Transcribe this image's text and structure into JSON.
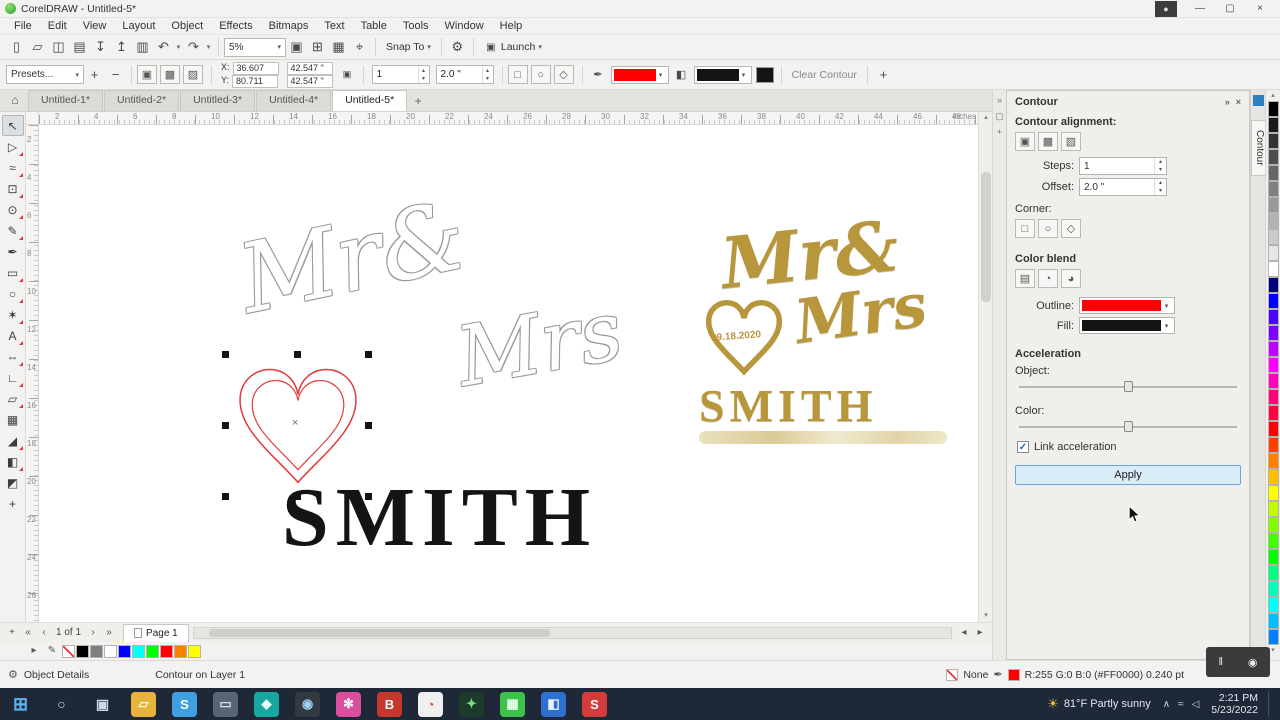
{
  "window": {
    "title": "CorelDRAW - Untitled-5*"
  },
  "icons": {
    "minimize": "—",
    "maximize": "▢",
    "close": "×",
    "account": "●",
    "dropdown": "▾",
    "plus": "+",
    "minus": "−",
    "gear": "⚙",
    "pen": "✒",
    "pencil": "✎",
    "house": "⌂",
    "check": "✓",
    "spin_up": "▴",
    "spin_down": "▾",
    "arrow_left": "◂",
    "arrow_right": "▸",
    "arrow_up": "▴",
    "arrow_down": "▾",
    "first": "«",
    "prev": "‹",
    "next": "›",
    "last": "»",
    "chevrons": "»",
    "panel": "▤",
    "page": "▢",
    "pause": "‖",
    "camera": "◉",
    "lock": "▣",
    "launch": "▣",
    "fill": "◧"
  },
  "menus": [
    "File",
    "Edit",
    "View",
    "Layout",
    "Object",
    "Effects",
    "Bitmaps",
    "Text",
    "Table",
    "Tools",
    "Window",
    "Help"
  ],
  "toolbar": {
    "left_icons": [
      {
        "name": "new-document-icon",
        "glyph": "▯"
      },
      {
        "name": "open-icon",
        "glyph": "▱"
      },
      {
        "name": "save-icon",
        "glyph": "◫"
      },
      {
        "name": "print-icon",
        "glyph": "▤"
      },
      {
        "name": "import-icon",
        "glyph": "↧"
      },
      {
        "name": "export-icon",
        "glyph": "↥"
      },
      {
        "name": "publish-pdf-icon",
        "glyph": "▥"
      },
      {
        "name": "undo-icon",
        "glyph": "↶"
      },
      {
        "name": "undo-dropdown-icon",
        "glyph": "▾"
      },
      {
        "name": "redo-icon",
        "glyph": "↷"
      },
      {
        "name": "redo-dropdown-icon",
        "glyph": "▾"
      }
    ],
    "zoom_value": "5%",
    "mid_icons": [
      {
        "name": "fullscreen-preview-icon",
        "glyph": "▣"
      },
      {
        "name": "show-rulers-icon",
        "glyph": "⊞"
      },
      {
        "name": "show-grid-icon",
        "glyph": "▦"
      },
      {
        "name": "guidelines-icon",
        "glyph": "⌖"
      }
    ],
    "snap_to_label": "Snap To",
    "launch_label": "Launch"
  },
  "property_bar": {
    "presets_label": "Presets...",
    "direction_icons": [
      {
        "name": "to-center-icon",
        "glyph": "▣"
      },
      {
        "name": "inside-contour-icon",
        "glyph": "▩"
      },
      {
        "name": "outside-contour-icon",
        "glyph": "▨"
      }
    ],
    "x_label": "X:",
    "x_value": "36.607",
    "y_label": "Y:",
    "y_value": "80.711",
    "width_value": "42.547 \"",
    "height_value": "42.547 \"",
    "steps_value": "1",
    "offset_value": "2.0 \"",
    "corner_icons": [
      {
        "name": "mitered-corner-icon",
        "glyph": "□"
      },
      {
        "name": "round-corner-icon",
        "glyph": "○"
      },
      {
        "name": "bevel-corner-icon",
        "glyph": "◇"
      }
    ],
    "outline_color": "#ff0000",
    "fill_color": "#141414",
    "clear_button": "Clear Contour"
  },
  "document_tabs": {
    "tabs": [
      "Untitled-1*",
      "Untitled-2*",
      "Untitled-3*",
      "Untitled-4*",
      "Untitled-5*"
    ],
    "active_index": 4
  },
  "ruler": {
    "units": "inches",
    "h_numbers": [
      "2",
      "4",
      "6",
      "8",
      "10",
      "12",
      "14",
      "16",
      "18",
      "20",
      "22",
      "24",
      "26",
      "28",
      "30",
      "32",
      "34",
      "36",
      "38",
      "40",
      "42",
      "44",
      "46",
      "48"
    ],
    "v_numbers": [
      "2",
      "4",
      "6",
      "8",
      "10",
      "12",
      "14",
      "16",
      "18",
      "20",
      "22",
      "24",
      "26"
    ]
  },
  "toolbox": [
    {
      "name": "pick-tool",
      "glyph": "↖",
      "selected": true
    },
    {
      "name": "shape-tool",
      "glyph": "▷",
      "badge": true
    },
    {
      "name": "smooth-tool",
      "glyph": "≈",
      "badge": true
    },
    {
      "name": "crop-tool",
      "glyph": "⊡",
      "badge": true
    },
    {
      "name": "zoom-tool",
      "glyph": "⊙",
      "badge": true
    },
    {
      "name": "freehand-tool",
      "glyph": "✎",
      "badge": true
    },
    {
      "name": "artistic-media-tool",
      "glyph": "✒"
    },
    {
      "name": "rectangle-tool",
      "glyph": "▭",
      "badge": true
    },
    {
      "name": "ellipse-tool",
      "glyph": "○",
      "badge": true
    },
    {
      "name": "polygon-tool",
      "glyph": "✶",
      "badge": true
    },
    {
      "name": "text-tool",
      "glyph": "A",
      "badge": true
    },
    {
      "name": "dimension-tool",
      "glyph": "⇔",
      "badge": true
    },
    {
      "name": "connector-tool",
      "glyph": "∟",
      "badge": true
    },
    {
      "name": "shadow-tool",
      "glyph": "▱",
      "badge": true
    },
    {
      "name": "transparency-tool",
      "glyph": "▦"
    },
    {
      "name": "eyedropper-tool",
      "glyph": "◢",
      "badge": true
    },
    {
      "name": "interactive-fill-tool",
      "glyph": "◧",
      "badge": true
    },
    {
      "name": "smart-fill-tool",
      "glyph": "◩"
    },
    {
      "name": "customize-toolbox-button",
      "glyph": "+"
    }
  ],
  "canvas": {
    "mr_text": "Mr&",
    "mrs_text": "Mrs",
    "smith_text": "SMITH",
    "heart_color": "#e23a3a",
    "selection_center": "×",
    "topper": {
      "mr": "Mr&",
      "mrs": "Mrs",
      "date": "09.18.2020",
      "name": "SMITH",
      "color": "#b8963b"
    }
  },
  "docker": {
    "title": "Contour",
    "tab_label": "Contour",
    "alignment_label": "Contour alignment:",
    "alignment_icons": [
      {
        "name": "contour-to-center-icon",
        "glyph": "▣"
      },
      {
        "name": "inside-contour-icon",
        "glyph": "▩"
      },
      {
        "name": "outside-contour-icon",
        "glyph": "▨"
      }
    ],
    "steps_label": "Steps:",
    "steps_value": "1",
    "offset_label": "Offset:",
    "offset_value": "2.0 \"",
    "corner_label": "Corner:",
    "corner_icons": [
      {
        "name": "mitered-corner-icon",
        "glyph": "□"
      },
      {
        "name": "round-corner-icon",
        "glyph": "○"
      },
      {
        "name": "bevel-corner-icon",
        "glyph": "◇"
      }
    ],
    "color_blend_label": "Color blend",
    "blend_icons": [
      {
        "name": "linear-blend-icon",
        "glyph": "▤"
      },
      {
        "name": "clockwise-blend-icon",
        "glyph": "◔"
      },
      {
        "name": "counterclockwise-blend-icon",
        "glyph": "◕"
      }
    ],
    "outline_label": "Outline:",
    "outline_color": "#ff0000",
    "fill_label": "Fill:",
    "fill_color": "#141414",
    "acceleration_label": "Acceleration",
    "object_label": "Object:",
    "color_label": "Color:",
    "link_label": "Link acceleration",
    "link_checked": true,
    "apply_label": "Apply"
  },
  "palette_right": [
    "#000000",
    "#1a1a1a",
    "#333333",
    "#4d4d4d",
    "#666666",
    "#808080",
    "#999999",
    "#b3b3b3",
    "#cccccc",
    "#e6e6e6",
    "#ffffff",
    "#00007f",
    "#0000ff",
    "#4c00ff",
    "#7f00ff",
    "#bf00ff",
    "#ff00ff",
    "#ff00bf",
    "#ff007f",
    "#ff0040",
    "#ff0000",
    "#ff4000",
    "#ff7f00",
    "#ffbf00",
    "#ffff00",
    "#bfff00",
    "#7fff00",
    "#40ff00",
    "#00ff00",
    "#00ff7f",
    "#00ffbf",
    "#00ffff",
    "#00bfff",
    "#007fff"
  ],
  "palette_bottom": [
    "none",
    "#000000",
    "#7f7f7f",
    "#ffffff",
    "#0000ff",
    "#00ffff",
    "#00ff00",
    "#ff0000",
    "#ff7f00",
    "#ffff00"
  ],
  "page_nav": {
    "info": "1 of 1",
    "tab": "Page 1"
  },
  "status_bar": {
    "details_label": "Object Details",
    "context": "Contour on Layer 1",
    "fill_label": "None",
    "outline_text": "R:255 G:0 B:0 (#FF0000)  0.240 pt"
  },
  "taskbar": {
    "apps": [
      {
        "name": "start-button",
        "glyph": "⊞",
        "bg": "transparent",
        "fg": "#5fb2f2",
        "fs": "18px"
      },
      {
        "name": "search-button",
        "glyph": "○",
        "bg": "transparent",
        "fg": "#d7e2ee",
        "fs": "14px"
      },
      {
        "name": "task-view-button",
        "glyph": "▣",
        "bg": "transparent",
        "fg": "#cdd9e5",
        "fs": "14px"
      },
      {
        "name": "file-explorer-icon",
        "glyph": "▱",
        "bg": "#e8b33c",
        "fg": "#fff7df"
      },
      {
        "name": "taskbar-app-1",
        "glyph": "S",
        "bg": "#3f9fe0",
        "fg": "#ffffff"
      },
      {
        "name": "taskbar-app-2",
        "glyph": "▭",
        "bg": "#5a6572",
        "fg": "#cfe3f2"
      },
      {
        "name": "taskbar-app-3",
        "glyph": "◆",
        "bg": "#18a7a0",
        "fg": "#eafffd"
      },
      {
        "name": "taskbar-app-4",
        "glyph": "◉",
        "bg": "#333a43",
        "fg": "#9fd1f5"
      },
      {
        "name": "taskbar-app-5",
        "glyph": "✻",
        "bg": "#d94f9e",
        "fg": "#ffffff"
      },
      {
        "name": "taskbar-app-6",
        "glyph": "B",
        "bg": "#c8372d",
        "fg": "#ffffff"
      },
      {
        "name": "taskbar-app-7",
        "glyph": "◔",
        "bg": "#f0f0f0",
        "fg": "#d7473a"
      },
      {
        "name": "taskbar-app-8",
        "glyph": "✦",
        "bg": "#1d3b2a",
        "fg": "#7ce27e"
      },
      {
        "name": "taskbar-app-9",
        "glyph": "▦",
        "bg": "#3fc24c",
        "fg": "#eafff0"
      },
      {
        "name": "taskbar-app-10",
        "glyph": "◧",
        "bg": "#2f6fd0",
        "fg": "#ecf4ff"
      },
      {
        "name": "taskbar-app-11",
        "glyph": "S",
        "bg": "#d43c3c",
        "fg": "#ffffff"
      }
    ],
    "weather_icon": "☀",
    "weather": "81°F  Partly sunny",
    "tray": [
      {
        "name": "tray-chevron-icon",
        "glyph": "∧"
      },
      {
        "name": "tray-network-icon",
        "glyph": "≈"
      },
      {
        "name": "tray-volume-icon",
        "glyph": "◁"
      }
    ],
    "time": "2:21 PM",
    "date": "5/23/2022"
  }
}
